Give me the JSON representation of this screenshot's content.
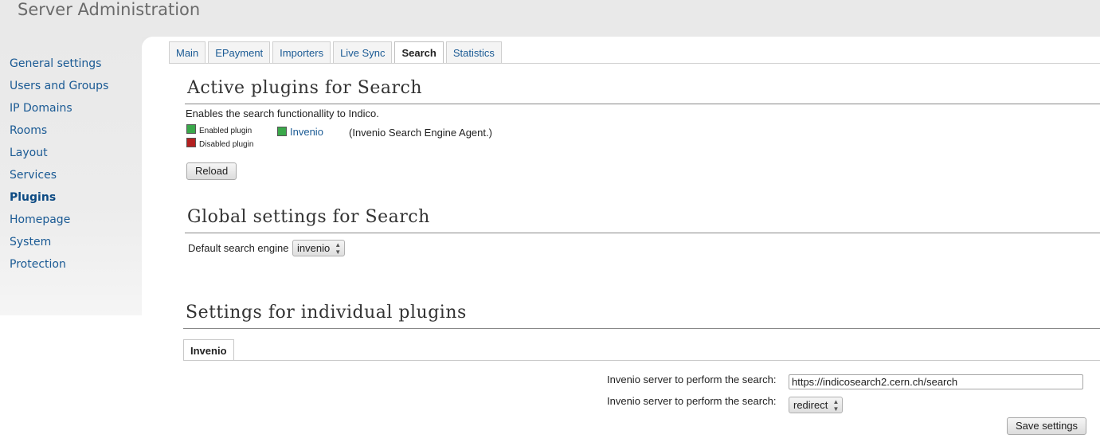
{
  "header": {
    "title": "Server Administration"
  },
  "sidebar": {
    "items": [
      {
        "label": "General settings"
      },
      {
        "label": "Users and Groups"
      },
      {
        "label": "IP Domains"
      },
      {
        "label": "Rooms"
      },
      {
        "label": "Layout"
      },
      {
        "label": "Services"
      },
      {
        "label": "Plugins"
      },
      {
        "label": "Homepage"
      },
      {
        "label": "System"
      },
      {
        "label": "Protection"
      }
    ],
    "active": "Plugins"
  },
  "tabs": [
    {
      "label": "Main"
    },
    {
      "label": "EPayment"
    },
    {
      "label": "Importers"
    },
    {
      "label": "Live Sync"
    },
    {
      "label": "Search"
    },
    {
      "label": "Statistics"
    }
  ],
  "active_tab": "Search",
  "active_plugins": {
    "title": "Active plugins for Search",
    "description": "Enables the search functionallity to Indico.",
    "legend_enabled": "Enabled plugin",
    "legend_disabled": "Disabled plugin",
    "plugin_name": "Invenio",
    "plugin_description": "(Invenio Search Engine Agent.)",
    "reload_label": "Reload"
  },
  "global_settings": {
    "title": "Global settings for Search",
    "engine_label": "Default search engine",
    "engine_value": "invenio"
  },
  "individual": {
    "title": "Settings for individual plugins",
    "tab_label": "Invenio",
    "server_label": "Invenio server to perform the search:",
    "server_value": "https://indicosearch2.cern.ch/search",
    "mode_label": "Invenio server to perform the search:",
    "mode_value": "redirect",
    "save_label": "Save settings"
  },
  "colors": {
    "link": "#1a5a94",
    "enabled": "#3aa84a",
    "disabled": "#b32020"
  }
}
